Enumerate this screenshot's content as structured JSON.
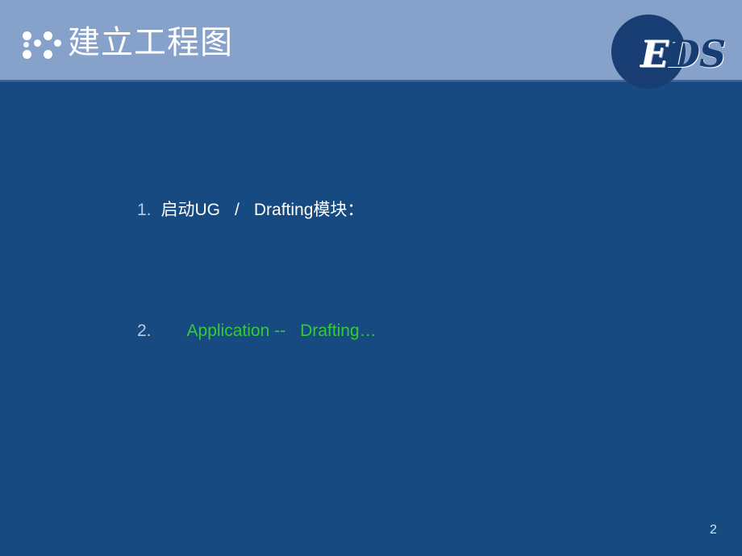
{
  "slide": {
    "page_number": "2",
    "colors": {
      "header_band": "#86a2cb",
      "body_background": "#164a81",
      "logo_circle": "#183d73",
      "accent_green": "#33cc33",
      "number_blue": "#b7cbe4",
      "title_white": "#ffffff"
    }
  },
  "header": {
    "title": "建立工程图",
    "ornament": "dot-cluster-icon",
    "logo": {
      "first_letter": "E",
      "rest_letters": "DS",
      "full_text": "EDS"
    }
  },
  "body": {
    "items": [
      {
        "number": "1.",
        "segments": [
          {
            "text": "启动UG",
            "color": "white"
          },
          {
            "text": "/",
            "color": "white"
          },
          {
            "text": "Drafting模块：",
            "color": "white"
          }
        ],
        "full_text": "启动UG / Drafting模块："
      },
      {
        "number": "2.",
        "segments": [
          {
            "text": "Application --",
            "color": "green"
          },
          {
            "text": "Drafting…",
            "color": "green"
          }
        ],
        "full_text": "Application --   Drafting…"
      }
    ]
  }
}
